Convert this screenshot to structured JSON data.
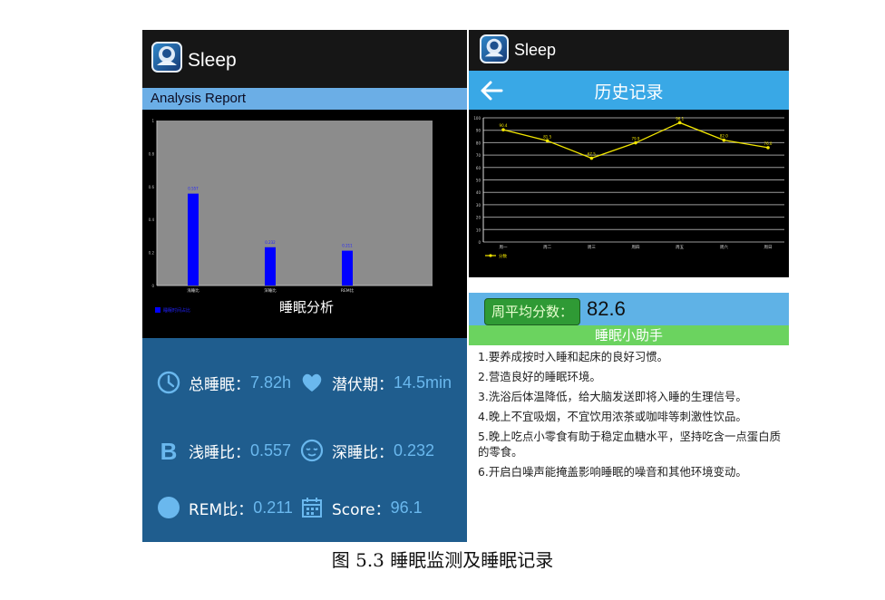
{
  "left_screen": {
    "app_title": "Sleep",
    "header_title": "Analysis Report",
    "chart_title": "睡眠分析",
    "stats": {
      "total_sleep_label": "总睡眠：",
      "total_sleep_value": "7.82h",
      "latency_label": "潜伏期：",
      "latency_value": "14.5min",
      "light_ratio_label": "浅睡比：",
      "light_ratio_value": "0.557",
      "deep_ratio_label": "深睡比：",
      "deep_ratio_value": "0.232",
      "rem_ratio_label": "REM比：",
      "rem_ratio_value": "0.211",
      "score_label": "Score：",
      "score_value": "96.1"
    },
    "icons": [
      "clock-icon",
      "heart-icon",
      "b-letter-icon",
      "sleepy-face-icon",
      "circle-icon",
      "calendar-icon"
    ]
  },
  "right_screen": {
    "app_title": "Sleep",
    "header_title": "历史记录",
    "avg_label": "周平均分数：",
    "avg_value": "82.6",
    "helper_title": "睡眠小助手",
    "tips": [
      "1.要养成按时入睡和起床的良好习惯。",
      "2.营造良好的睡眠环境。",
      "3.洗浴后体温降低，给大脑发送即将入睡的生理信号。",
      "4.晚上不宜吸烟，不宜饮用浓茶或咖啡等刺激性饮品。",
      "5.晚上吃点小零食有助于稳定血糖水平，坚持吃含一点蛋白质的零食。",
      "6.开启白噪声能掩盖影响睡眠的噪音和其他环境变动。"
    ],
    "icons": [
      "back-arrow-icon"
    ]
  },
  "caption": "图 5.3  睡眠监测及睡眠记录",
  "colors": {
    "left_background": "#1f5d8e",
    "value_blue": "#6ab8ee",
    "bar_blue": "#0000ff",
    "chart_plot_gray": "#8c8c8c",
    "line_yellow": "#f2e600",
    "history_header_blue": "#39a8e6",
    "avg_button_green": "#2f9a35",
    "helper_header_green": "#6bd35f"
  },
  "chart_data": [
    {
      "type": "bar",
      "title": "睡眠分析",
      "categories": [
        "浅睡比",
        "深睡比",
        "REM比"
      ],
      "values": [
        0.557,
        0.232,
        0.211
      ],
      "data_labels": [
        "0.557",
        "0.232",
        "0.211"
      ],
      "ylim": [
        0,
        1
      ],
      "yticks": [
        "0",
        "0.2",
        "0.4",
        "0.6",
        "0.8",
        "1"
      ],
      "legend": [
        "睡眠时间占比"
      ],
      "legend_position": "bottom-left",
      "grid": false
    },
    {
      "type": "line",
      "categories": [
        "周一",
        "周二",
        "周三",
        "周四",
        "周五",
        "周六",
        "周日"
      ],
      "series": [
        {
          "name": "分数",
          "values": [
            90.4,
            81.5,
            67.5,
            79.9,
            96.1,
            82.0,
            76.0
          ]
        }
      ],
      "data_labels": [
        "90.4",
        "81.5",
        "67.5",
        "79.9",
        "96.1",
        "82.0",
        "76.0"
      ],
      "ylim": [
        0,
        100
      ],
      "yticks": [
        "0",
        "10",
        "20",
        "30",
        "40",
        "50",
        "60",
        "70",
        "80",
        "90",
        "100"
      ],
      "legend_position": "bottom-left",
      "grid": true
    }
  ]
}
